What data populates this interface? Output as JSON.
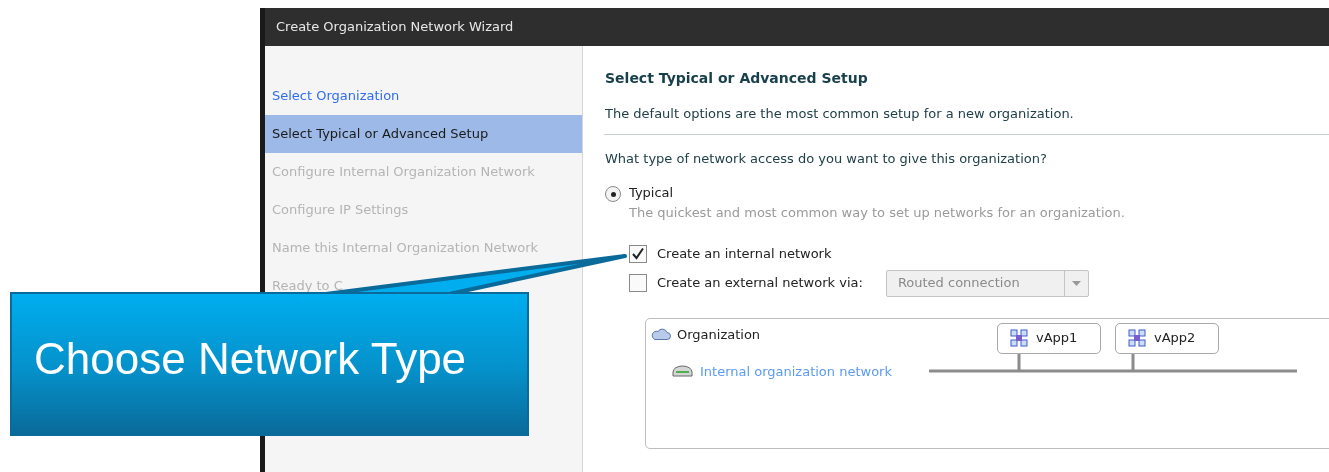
{
  "window": {
    "title": "Create Organization Network Wizard"
  },
  "steps": [
    {
      "label": "Select Organization",
      "selected": false,
      "disabled": false
    },
    {
      "label": "Select Typical or Advanced Setup",
      "selected": true,
      "disabled": false
    },
    {
      "label": "Configure Internal Organization Network",
      "selected": false,
      "disabled": true
    },
    {
      "label": "Configure IP Settings",
      "selected": false,
      "disabled": true
    },
    {
      "label": "Name this Internal Organization Network",
      "selected": false,
      "disabled": true
    },
    {
      "label": "Ready to C",
      "selected": false,
      "disabled": true
    }
  ],
  "page": {
    "heading": "Select Typical or Advanced Setup",
    "description": "The default options are the most common setup for a new organization.",
    "question": "What type of network access do you want to give this organization?"
  },
  "options": [
    {
      "kind": "radio",
      "label": "Typical",
      "description": "The quickest and most common way to set up networks for an organization.",
      "checked": true
    },
    {
      "kind": "checkbox",
      "label": "Create an internal network",
      "checked": true
    },
    {
      "kind": "checkbox",
      "label": "Create an external network via:",
      "checked": false,
      "dropdown": {
        "value": "Routed connection",
        "disabled": true
      }
    }
  ],
  "diagram": {
    "organization": "Organization",
    "network": "Internal organization network",
    "vapps": [
      "vApp1",
      "vApp2"
    ]
  },
  "callout": {
    "text": "Choose Network Type"
  }
}
